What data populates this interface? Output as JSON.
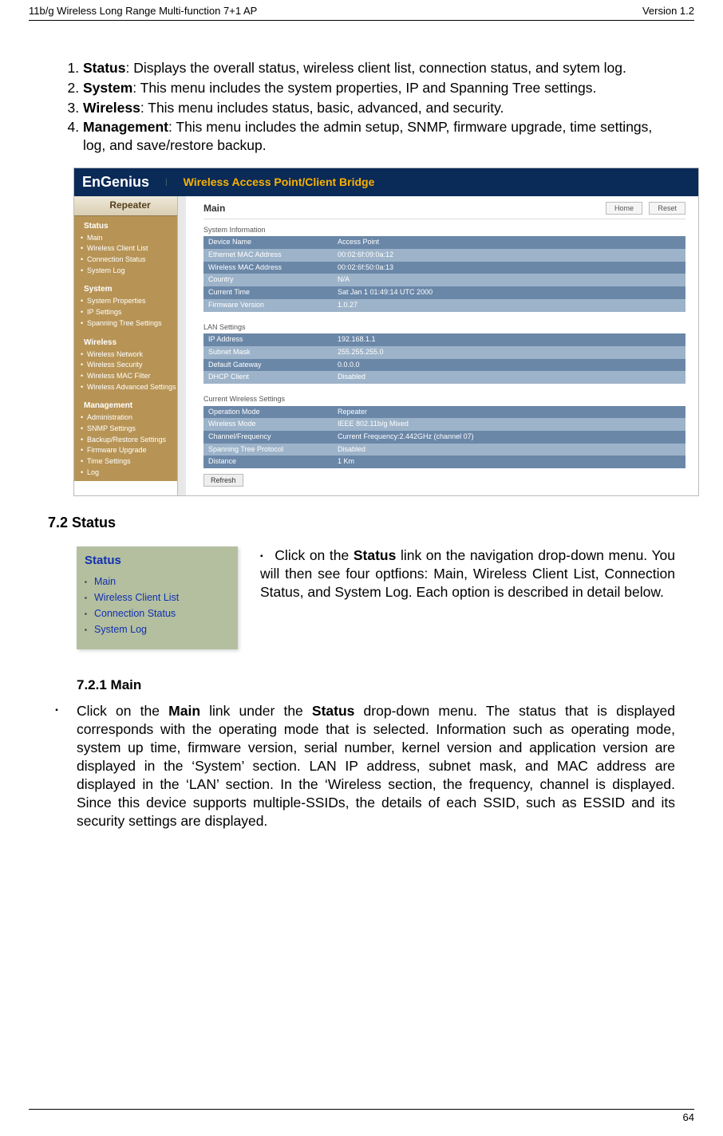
{
  "header": {
    "left": "11b/g Wireless Long Range Multi-function 7+1 AP",
    "right": "Version 1.2"
  },
  "intro_list": [
    {
      "label": "Status",
      "text": ": Displays the overall status, wireless client list, connection status, and sytem log."
    },
    {
      "label": "System",
      "text": ": This menu includes the system properties, IP and Spanning Tree settings."
    },
    {
      "label": "Wireless",
      "text": ": This menu includes status, basic, advanced, and security."
    },
    {
      "label": "Management",
      "text": ": This menu includes the admin setup, SNMP, firmware upgrade, time settings, log, and save/restore backup."
    }
  ],
  "router": {
    "brand": "EnGenius",
    "title": "Wireless Access Point/Client Bridge",
    "mode": "Repeater",
    "sidebar": {
      "sections": [
        {
          "head": "Status",
          "items": [
            "Main",
            "Wireless Client List",
            "Connection Status",
            "System Log"
          ]
        },
        {
          "head": "System",
          "items": [
            "System Properties",
            "IP Settings",
            "Spanning Tree Settings"
          ]
        },
        {
          "head": "Wireless",
          "items": [
            "Wireless Network",
            "Wireless Security",
            "Wireless MAC Filter",
            "Wireless Advanced Settings"
          ]
        },
        {
          "head": "Management",
          "items": [
            "Administration",
            "SNMP Settings",
            "Backup/Restore Settings",
            "Firmware Upgrade",
            "Time Settings",
            "Log"
          ]
        }
      ]
    },
    "main": {
      "heading": "Main",
      "buttons": {
        "home": "Home",
        "reset": "Reset"
      },
      "refresh_label": "Refresh",
      "tables": [
        {
          "caption": "System Information",
          "rows": [
            [
              "Device Name",
              "Access Point"
            ],
            [
              "Ethernet MAC Address",
              "00:02:6f:09:0a:12"
            ],
            [
              "Wireless MAC Address",
              "00:02:6f:50:0a:13"
            ],
            [
              "Country",
              "N/A"
            ],
            [
              "Current Time",
              "Sat Jan 1 01:49:14 UTC 2000"
            ],
            [
              "Firmware Version",
              "1.0.27"
            ]
          ]
        },
        {
          "caption": "LAN Settings",
          "rows": [
            [
              "IP Address",
              "192.168.1.1"
            ],
            [
              "Subnet Mask",
              "255.255.255.0"
            ],
            [
              "Default Gateway",
              "0.0.0.0"
            ],
            [
              "DHCP Client",
              "Disabled"
            ]
          ]
        },
        {
          "caption": "Current Wireless Settings",
          "rows": [
            [
              "Operation Mode",
              "Repeater"
            ],
            [
              "Wireless Mode",
              "IEEE 802.11b/g Mixed"
            ],
            [
              "Channel/Frequency",
              "Current Frequency:2.442GHz (channel 07)"
            ],
            [
              "Spanning Tree Protocol",
              "Disabled"
            ],
            [
              "Distance",
              "1 Km"
            ]
          ]
        }
      ]
    }
  },
  "section_status": {
    "heading": "7.2 Status",
    "menu_title": "Status",
    "menu_items": [
      "Main",
      "Wireless Client List",
      "Connection Status",
      "System Log"
    ],
    "para_prefix": "Click on the ",
    "para_bold": "Status",
    "para_suffix": " link on the navigation drop-down menu. You will then see four optfions: Main, Wireless Client List, Connection Status, and System Log. Each option is described in detail below."
  },
  "section_main": {
    "heading": "7.2.1   Main",
    "pre1": "Click on the ",
    "b1": "Main",
    "mid1": " link under the ",
    "b2": "Status",
    "post1": " drop-down menu. The status that is displayed corresponds with the operating mode that is selected. Information such as operating mode, system up time, firmware version, serial number, kernel version and application version are displayed in the ‘System’ section. LAN IP address, subnet mask, and MAC address are displayed in the ‘LAN’ section. In the ‘Wireless section, the frequency, channel is displayed. Since this device supports multiple-SSIDs, the details of each SSID, such as ESSID and its security settings are displayed."
  },
  "footer": {
    "page": "64"
  }
}
